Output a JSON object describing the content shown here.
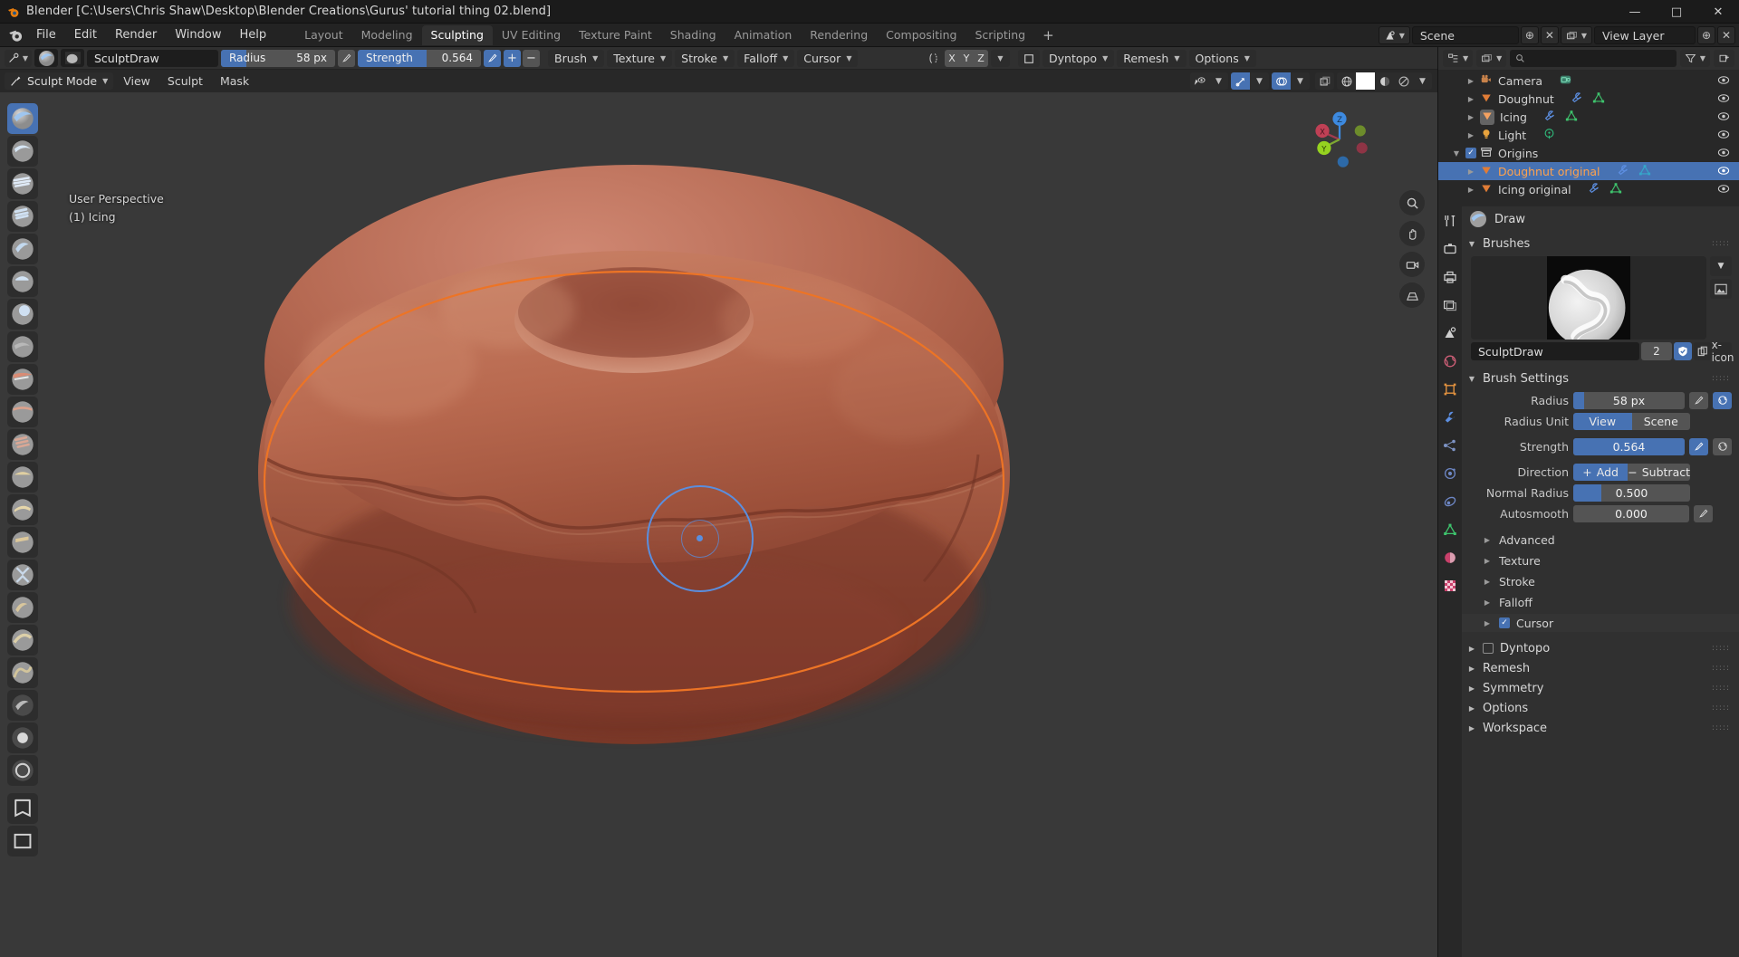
{
  "window": {
    "title": "Blender [C:\\Users\\Chris Shaw\\Desktop\\Blender Creations\\Gurus' tutorial thing 02.blend]",
    "minimize": "—",
    "maximize": "□",
    "close": "✕"
  },
  "menu": [
    "File",
    "Edit",
    "Render",
    "Window",
    "Help"
  ],
  "workspaces": {
    "tabs": [
      "Layout",
      "Modeling",
      "Sculpting",
      "UV Editing",
      "Texture Paint",
      "Shading",
      "Animation",
      "Rendering",
      "Compositing",
      "Scripting"
    ],
    "active": "Sculpting",
    "add_label": "+"
  },
  "topbar_right": {
    "scene_name": "Scene",
    "view_layer_name": "View Layer",
    "new_label": "⊕",
    "unlink_label": "✕"
  },
  "tool_settings": {
    "brush_name": "SculptDraw",
    "radius_label": "Radius",
    "radius_value": "58 px",
    "radius_fill_pct": 22,
    "strength_label": "Strength",
    "strength_value": "0.564",
    "strength_fill_pct": 56,
    "direction_add": "+",
    "direction_subtract": "−",
    "dropdowns": [
      "Brush",
      "Texture",
      "Stroke",
      "Falloff",
      "Cursor"
    ],
    "axes": [
      "X",
      "Y",
      "Z"
    ],
    "dyntopo": "Dyntopo",
    "remesh": "Remesh",
    "options": "Options"
  },
  "viewport_header": {
    "mode": "Sculpt Mode",
    "menus": [
      "View",
      "Sculpt",
      "Mask"
    ]
  },
  "viewport": {
    "perspective_text": "User Perspective",
    "object_text": "(1) Icing",
    "gizmo_axes": [
      "X",
      "Y",
      "Z"
    ]
  },
  "outliner": {
    "display_mode": "View Layer",
    "search_placeholder": "",
    "rows": [
      {
        "name": "Camera",
        "icon": "camera-icon",
        "depth": 2,
        "selected": false,
        "has_expand": true,
        "badges": [
          "camera-data"
        ]
      },
      {
        "name": "Doughnut",
        "icon": "mesh-icon",
        "depth": 2,
        "selected": false,
        "has_expand": true,
        "badges": [
          "modifier",
          "mesh-data"
        ]
      },
      {
        "name": "Icing",
        "icon": "mesh-icon",
        "depth": 2,
        "selected": false,
        "has_expand": true,
        "active": true,
        "badges": [
          "modifier",
          "mesh-data"
        ]
      },
      {
        "name": "Light",
        "icon": "light-icon",
        "depth": 2,
        "selected": false,
        "has_expand": true,
        "badges": [
          "light-data"
        ]
      },
      {
        "name": "Origins",
        "icon": "collection-icon",
        "depth": 1,
        "selected": false,
        "has_expand": false,
        "checkbox": true,
        "badges": []
      },
      {
        "name": "Doughnut original",
        "icon": "mesh-icon",
        "depth": 2,
        "selected": true,
        "has_expand": true,
        "badges": [
          "modifier",
          "mesh-data"
        ]
      },
      {
        "name": "Icing original",
        "icon": "mesh-icon",
        "depth": 2,
        "selected": false,
        "has_expand": true,
        "badges": [
          "modifier",
          "mesh-data"
        ]
      }
    ]
  },
  "properties": {
    "header_title": "Draw",
    "panels": {
      "brushes": "Brushes",
      "brush_settings": "Brush Settings"
    },
    "brush": {
      "name": "SculptDraw",
      "users": "2",
      "fake_user_icon": "shield-icon",
      "duplicate_icon": "copy-icon",
      "delete_icon": "x-icon"
    },
    "settings": [
      {
        "label": "Radius",
        "value": "58 px",
        "fill_pct": 10,
        "type": "slider",
        "icons": [
          "pen-pressure",
          "unified"
        ]
      },
      {
        "label": "Radius Unit",
        "type": "toggle",
        "options": [
          "View",
          "Scene"
        ],
        "active": "View"
      },
      {
        "label": "Strength",
        "value": "0.564",
        "fill_pct": 100,
        "type": "slider",
        "icons": [
          "pen-pressure-on",
          "unified"
        ]
      },
      {
        "label": "Direction",
        "type": "toggle",
        "options": [
          "Add",
          "Subtract"
        ],
        "active": "Add",
        "prefixes": [
          "+",
          "−"
        ]
      },
      {
        "label": "Normal Radius",
        "value": "0.500",
        "fill_pct": 24,
        "type": "slider",
        "icons": []
      },
      {
        "label": "Autosmooth",
        "value": "0.000",
        "fill_pct": 0,
        "type": "slider",
        "icons": [
          "pen-pressure"
        ]
      }
    ],
    "subpanels": [
      {
        "label": "Advanced",
        "checkbox": null
      },
      {
        "label": "Texture",
        "checkbox": null
      },
      {
        "label": "Stroke",
        "checkbox": null
      },
      {
        "label": "Falloff",
        "checkbox": null
      },
      {
        "label": "Cursor",
        "checkbox": true
      }
    ],
    "toppanels": [
      {
        "label": "Dyntopo",
        "checkbox": false
      },
      {
        "label": "Remesh",
        "checkbox": null
      },
      {
        "label": "Symmetry",
        "checkbox": null
      },
      {
        "label": "Options",
        "checkbox": null
      },
      {
        "label": "Workspace",
        "checkbox": null
      }
    ],
    "tabs": [
      "tool-icon",
      "render-icon",
      "output-icon",
      "viewlayer-icon",
      "scene-icon",
      "world-icon",
      "object-icon",
      "modifier-icon",
      "particles-icon",
      "physics-icon",
      "constraint-icon",
      "data-icon",
      "material-icon",
      "texture-icon"
    ]
  },
  "colors": {
    "accent_blue": "#4772b3",
    "selected_orange": "#ffa24d",
    "outline_orange": "#ed7425",
    "panel_bg": "#303030",
    "viewport_bg": "#393939",
    "donut_base": "#b35f49"
  }
}
